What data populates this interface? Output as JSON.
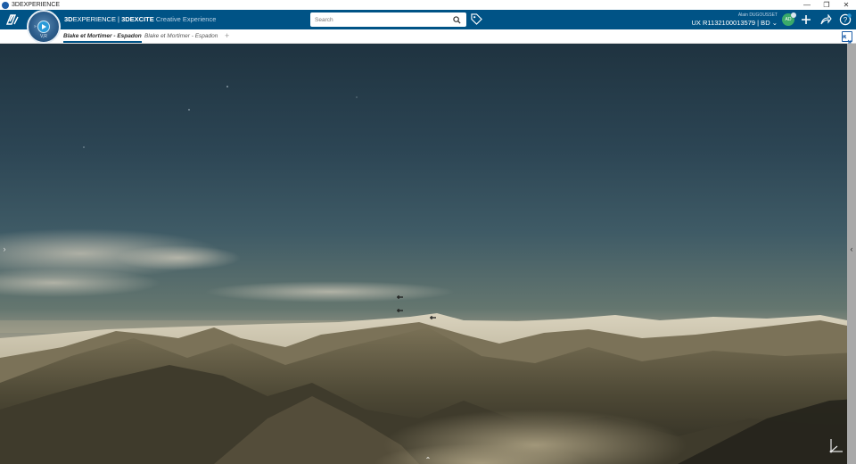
{
  "os": {
    "title": "3DEXPERIENCE",
    "controls": [
      "—",
      "❐",
      "✕"
    ]
  },
  "topbar": {
    "brand_bold": "3D",
    "brand_main": "EXPERIENCE",
    "separator": " | ",
    "app_name": "3DEXCITE",
    "app_sub": "Creative Experience",
    "compass_label": "V,R",
    "search": {
      "placeholder": "Search",
      "value": ""
    },
    "user_name": "Alain DUGOUSSET",
    "context": "UX R1132100013579 | BD ",
    "avatar_initials": "AD"
  },
  "tabs": [
    {
      "label": "Blake et Mortimer - Espadon"
    },
    {
      "label": "Blake et Mortimer - Espadon"
    }
  ],
  "tab_add": "+",
  "viewer": {
    "left_handle": "›",
    "right_handle": "‹",
    "bottom_handle": "⌃"
  },
  "colors": {
    "brand": "#005386",
    "accent": "#2a9ad8"
  }
}
